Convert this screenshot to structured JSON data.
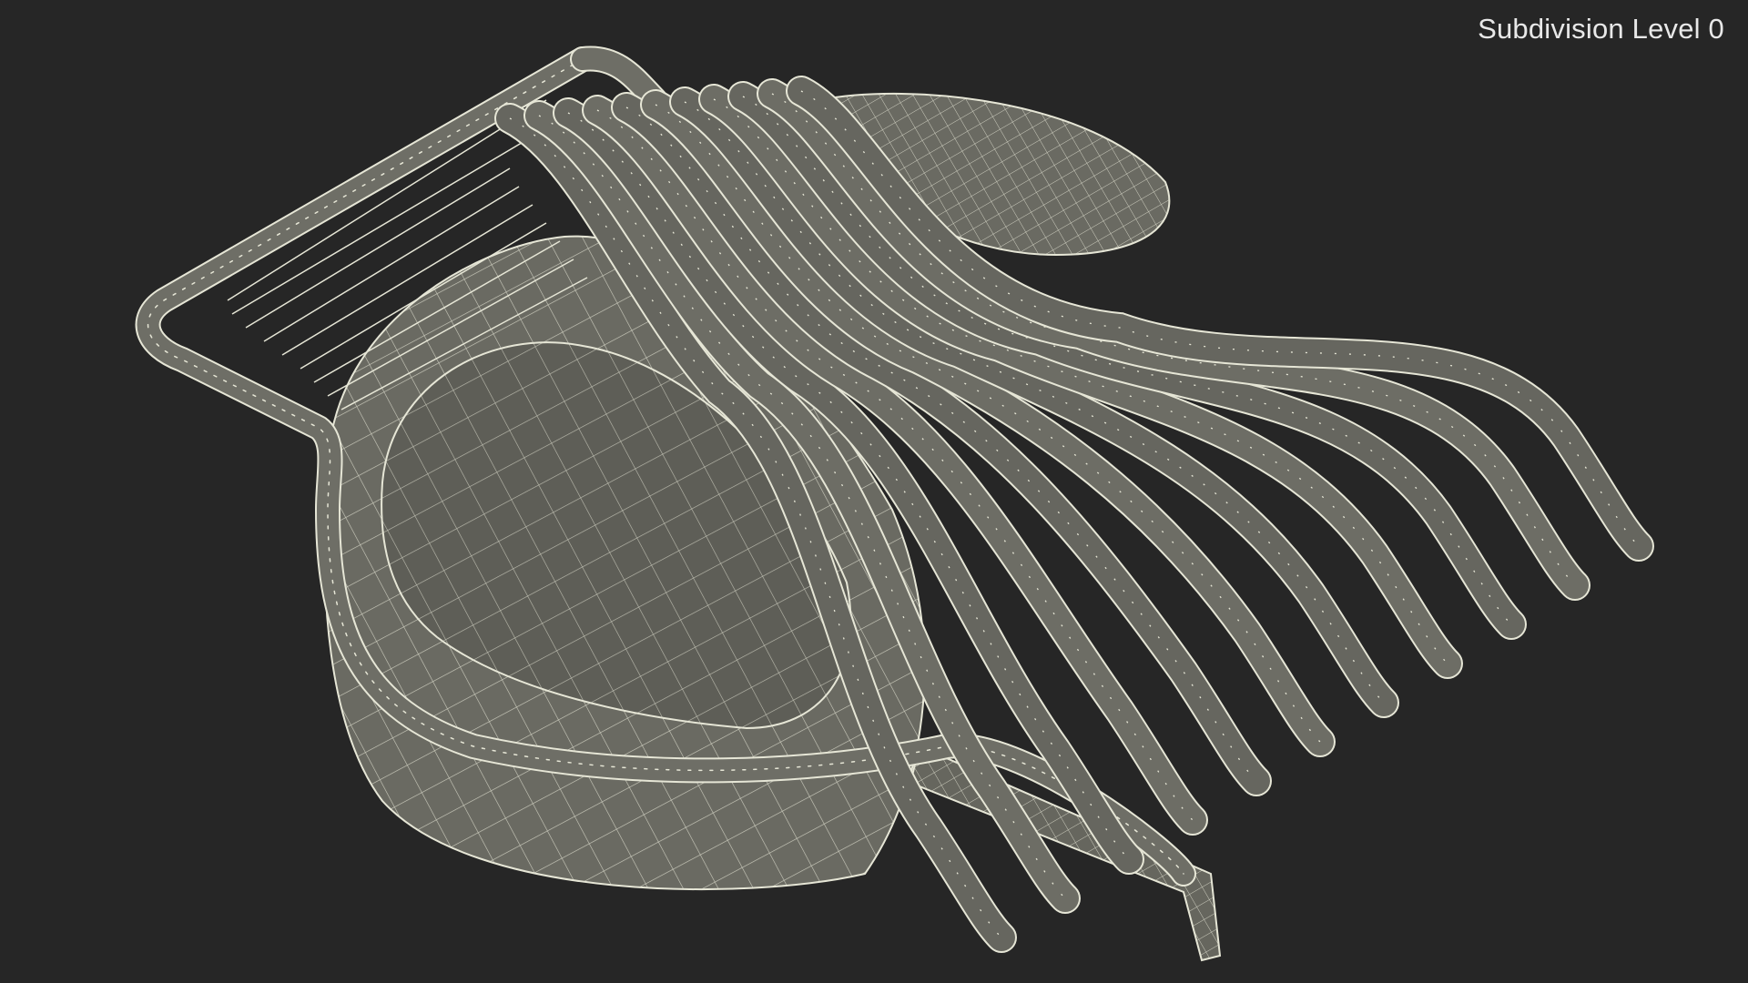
{
  "viewport": {
    "label": "Subdivision Level 0",
    "background": "#262626",
    "mesh_fill": "#6f6f66",
    "mesh_fill_dark": "#55554e",
    "wire_color": "#e6e6d6"
  },
  "model": {
    "slicer_ribs": 11,
    "cutting_wires": 9
  }
}
